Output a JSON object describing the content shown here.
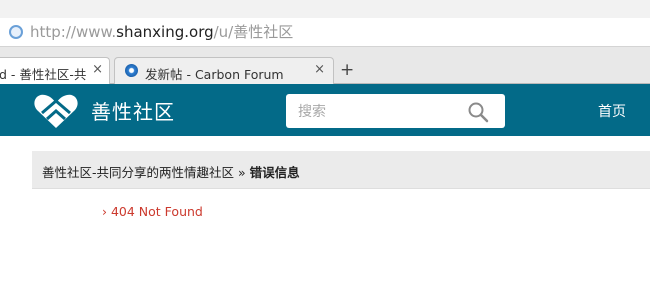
{
  "browser": {
    "url_prefix": "http://www.",
    "url_domain": "shanxing.org",
    "url_path": "/u/善性社区",
    "tabs": [
      {
        "title": "d - 善性社区-共",
        "close": "×",
        "active": true
      },
      {
        "title": "发新帖 - Carbon Forum",
        "close": "×",
        "active": false
      }
    ],
    "new_tab": "+"
  },
  "site": {
    "name": "善性社区",
    "brand_color": "#036a88",
    "search_placeholder": "搜索",
    "nav_home": "首页"
  },
  "breadcrumb": {
    "parent": "善性社区-共同分享的两性情趣社区",
    "separator": "»",
    "current": "错误信息"
  },
  "error": {
    "message": "› 404 Not Found",
    "color": "#cc3a2e"
  }
}
